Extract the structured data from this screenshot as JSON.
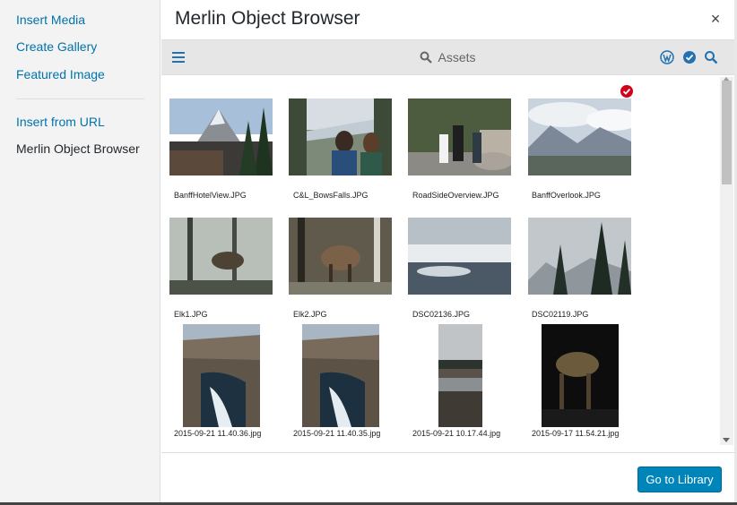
{
  "sidebar": {
    "items": [
      {
        "label": "Insert Media"
      },
      {
        "label": "Create Gallery"
      },
      {
        "label": "Featured Image"
      },
      {
        "label": "Insert from URL"
      },
      {
        "label": "Merlin Object Browser"
      }
    ]
  },
  "header": {
    "title": "Merlin Object Browser",
    "close_glyph": "×"
  },
  "toolbar": {
    "title": "Assets",
    "icons": [
      "menu-icon",
      "search-icon",
      "wordpress-icon",
      "check-circle-icon",
      "search-icon"
    ]
  },
  "assets": [
    {
      "filename": "BanffHotelView.JPG",
      "selected": false
    },
    {
      "filename": "C&L_BowsFalls.JPG",
      "selected": false
    },
    {
      "filename": "RoadSideOverview.JPG",
      "selected": false
    },
    {
      "filename": "BanffOverlook.JPG",
      "selected": true
    },
    {
      "filename": "Elk1.JPG",
      "selected": false
    },
    {
      "filename": "Elk2.JPG",
      "selected": false
    },
    {
      "filename": "DSC02136.JPG",
      "selected": false
    },
    {
      "filename": "DSC02119.JPG",
      "selected": false
    },
    {
      "filename": "2015-09-21 11.40.36.jpg",
      "selected": false
    },
    {
      "filename": "2015-09-21 11.40.35.jpg",
      "selected": false
    },
    {
      "filename": "2015-09-21 10.17.44.jpg",
      "selected": false
    },
    {
      "filename": "2015-09-17 11.54.21.jpg",
      "selected": false
    }
  ],
  "footer": {
    "primary_button": "Go to Library"
  },
  "colors": {
    "link": "#0073aa",
    "primary": "#0085ba",
    "selected_badge": "#d0021b"
  }
}
